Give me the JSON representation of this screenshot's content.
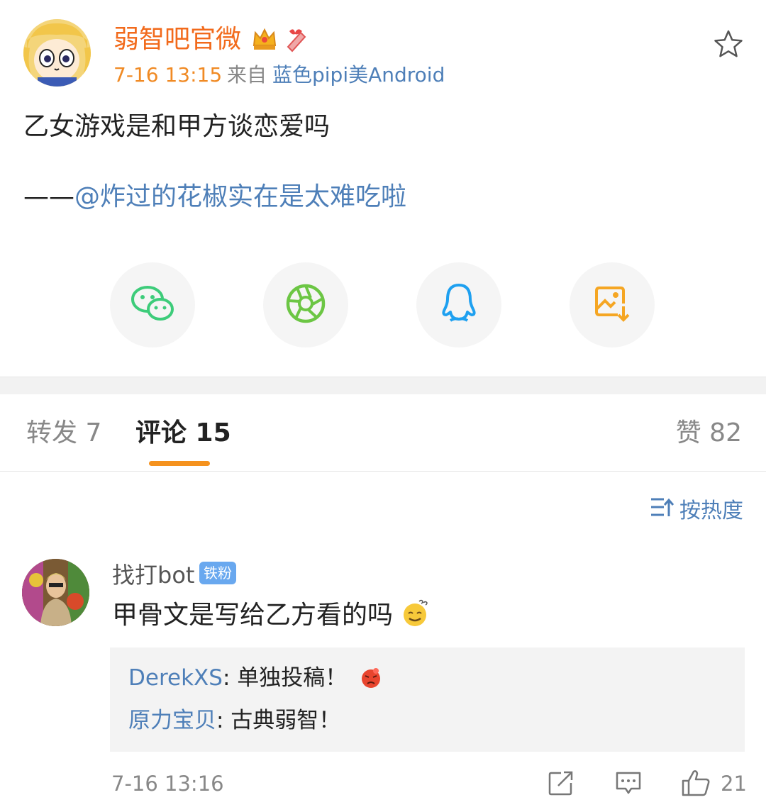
{
  "post": {
    "author": "弱智吧官微",
    "time": "7-16 13:15",
    "source_prefix": "来自",
    "source": "蓝色pipi美Android",
    "text": "乙女游戏是和甲方谈恋爱吗",
    "attribution_dash": "——",
    "attribution_mention": "@炸过的花椒实在是太难吃啦",
    "badge_icons": [
      "crown-icon",
      "gift-icon"
    ]
  },
  "share": {
    "items": [
      {
        "name": "wechat",
        "icon": "wechat-icon",
        "color": "#3dcc7a"
      },
      {
        "name": "moments",
        "icon": "moments-icon",
        "color": "#6cc644"
      },
      {
        "name": "qq",
        "icon": "qq-icon",
        "color": "#1ea0f0"
      },
      {
        "name": "save-image",
        "icon": "save-image-icon",
        "color": "#f5a623"
      }
    ]
  },
  "tabs": {
    "repost": "转发 7",
    "comment": "评论 15",
    "like": "赞 82"
  },
  "sort": {
    "label": "按热度"
  },
  "comment": {
    "user": "找打bot",
    "badge": "铁粉",
    "text": "甲骨文是写给乙方看的吗",
    "time": "7-16 13:16",
    "likes": "21",
    "replies": [
      {
        "user": "DerekXS",
        "text": ": 单独投稿！"
      },
      {
        "user": "原力宝贝",
        "text": ": 古典弱智！"
      }
    ]
  },
  "colors": {
    "accent": "#f5921e",
    "link": "#4e7fb8",
    "author": "#f26a1b"
  }
}
